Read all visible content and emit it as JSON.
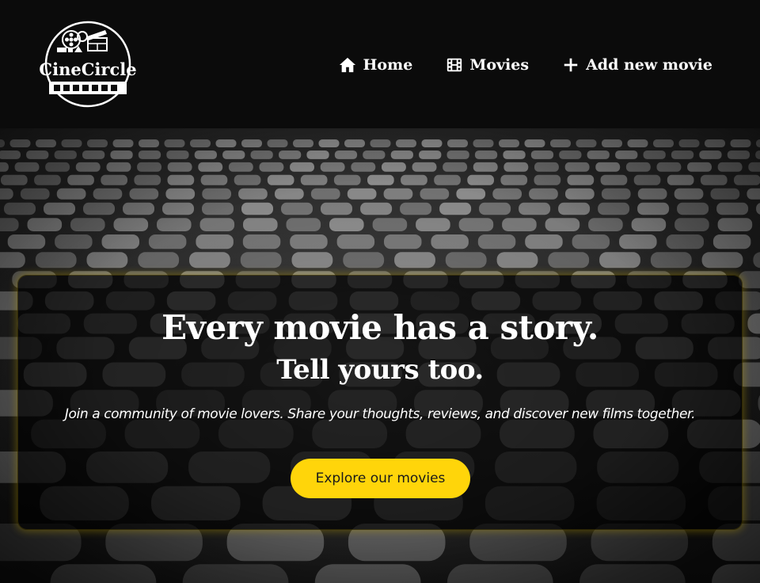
{
  "brand": {
    "name": "CineCircle",
    "logo_icon": "film-reel-clapperboard-logo"
  },
  "nav": {
    "items": [
      {
        "label": "Home",
        "icon": "home-icon"
      },
      {
        "label": "Movies",
        "icon": "film-icon"
      },
      {
        "label": "Add new movie",
        "icon": "plus-icon"
      }
    ]
  },
  "hero": {
    "background": "black-and-white cinema seats photo",
    "title": "Every movie has a story.",
    "subtitle": "Tell yours too.",
    "text": "Join a community of movie lovers. Share your thoughts, reviews, and discover new films together.",
    "cta_label": "Explore our movies"
  },
  "colors": {
    "header_bg": "#0b0b0b",
    "accent": "#ffd50a",
    "card_glow": "#c8aa00",
    "text": "#ffffff"
  }
}
